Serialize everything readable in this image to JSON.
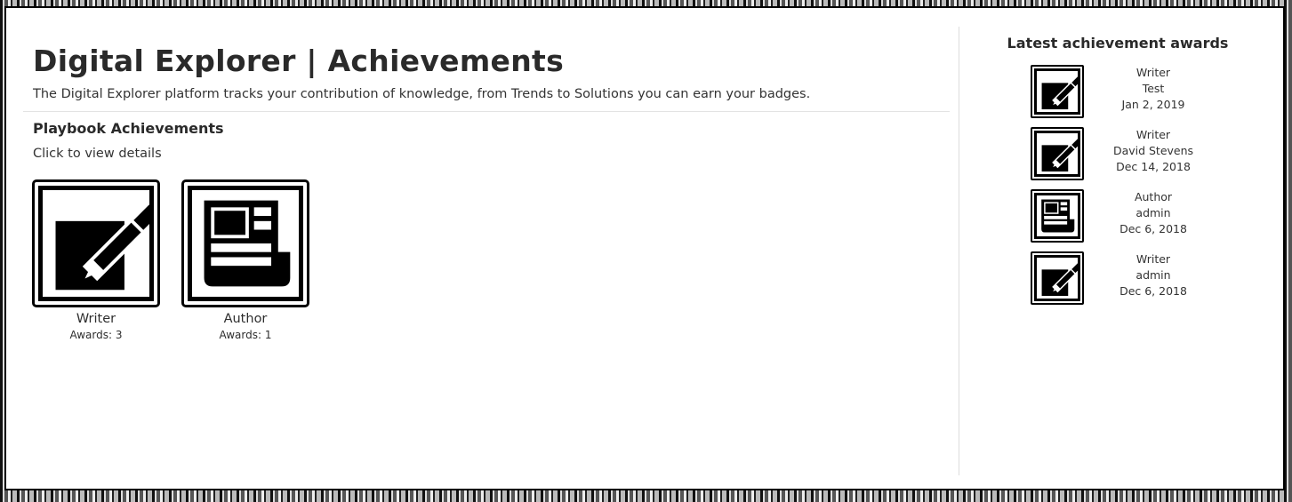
{
  "page": {
    "title": "Digital Explorer | Achievements",
    "subtitle": "The Digital Explorer platform tracks your contribution of knowledge, from Trends to Solutions you can earn your badges."
  },
  "playbook": {
    "heading": "Playbook Achievements",
    "hint": "Click to view details",
    "badges": [
      {
        "name": "Writer",
        "awards": "Awards: 3",
        "icon": "writer-pencil-icon"
      },
      {
        "name": "Author",
        "awards": "Awards: 1",
        "icon": "author-newspaper-icon"
      }
    ]
  },
  "latest": {
    "heading": "Latest achievement awards",
    "items": [
      {
        "badge": "Writer",
        "user": "Test",
        "date": "Jan 2, 2019",
        "icon": "writer-pencil-icon"
      },
      {
        "badge": "Writer",
        "user": "David Stevens",
        "date": "Dec 14, 2018",
        "icon": "writer-pencil-icon"
      },
      {
        "badge": "Author",
        "user": "admin",
        "date": "Dec 6, 2018",
        "icon": "author-newspaper-icon"
      },
      {
        "badge": "Writer",
        "user": "admin",
        "date": "Dec 6, 2018",
        "icon": "writer-pencil-icon"
      }
    ]
  },
  "colors": {
    "background": "#ffffff",
    "text": "#2b2b2b",
    "badge_ink": "#000000",
    "divider": "#dcdcdc"
  }
}
